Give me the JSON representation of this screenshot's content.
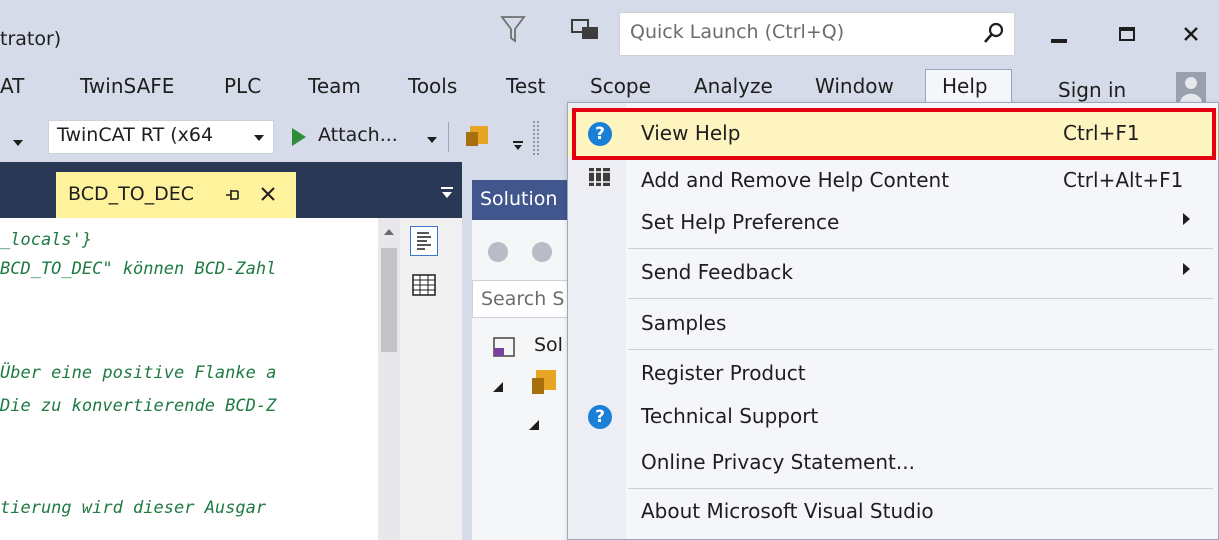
{
  "window": {
    "title": "trator)",
    "quick_launch_placeholder": "Quick Launch (Ctrl+Q)"
  },
  "menu": {
    "items": [
      "AT",
      "TwinSAFE",
      "PLC",
      "Team",
      "Tools",
      "Test",
      "Scope",
      "Analyze",
      "Window",
      "Help"
    ],
    "sign_in": "Sign in"
  },
  "toolbar": {
    "platform_combo": "TwinCAT RT (x64",
    "attach_label": "Attach..."
  },
  "editor": {
    "tab_label": "BCD_TO_DEC",
    "code_lines": [
      "_locals'}",
      "BCD_TO_DEC\" können BCD-Zahl",
      "",
      "Über eine positive Flanke a",
      "Die zu konvertierende BCD-Z",
      "",
      "tierung wird dieser Ausgar"
    ]
  },
  "solution_explorer": {
    "title": "Solution",
    "search_placeholder": "Search S",
    "tree_item": "Sol"
  },
  "help_menu": {
    "items": [
      {
        "label": "View Help",
        "shortcut": "Ctrl+F1",
        "icon": "help-circle-icon"
      },
      {
        "label": "Add and Remove Help Content",
        "shortcut": "Ctrl+Alt+F1",
        "icon": "books-icon"
      },
      {
        "label": "Set Help Preference",
        "submenu": true
      },
      {
        "label": "Send Feedback",
        "submenu": true
      },
      {
        "label": "Samples"
      },
      {
        "label": "Register Product"
      },
      {
        "label": "Technical Support",
        "icon": "help-circle-icon"
      },
      {
        "label": "Online Privacy Statement..."
      },
      {
        "label": "About Microsoft Visual Studio"
      }
    ],
    "highlight_color": "#e3000f",
    "icon_color": "#1a7fd6"
  }
}
